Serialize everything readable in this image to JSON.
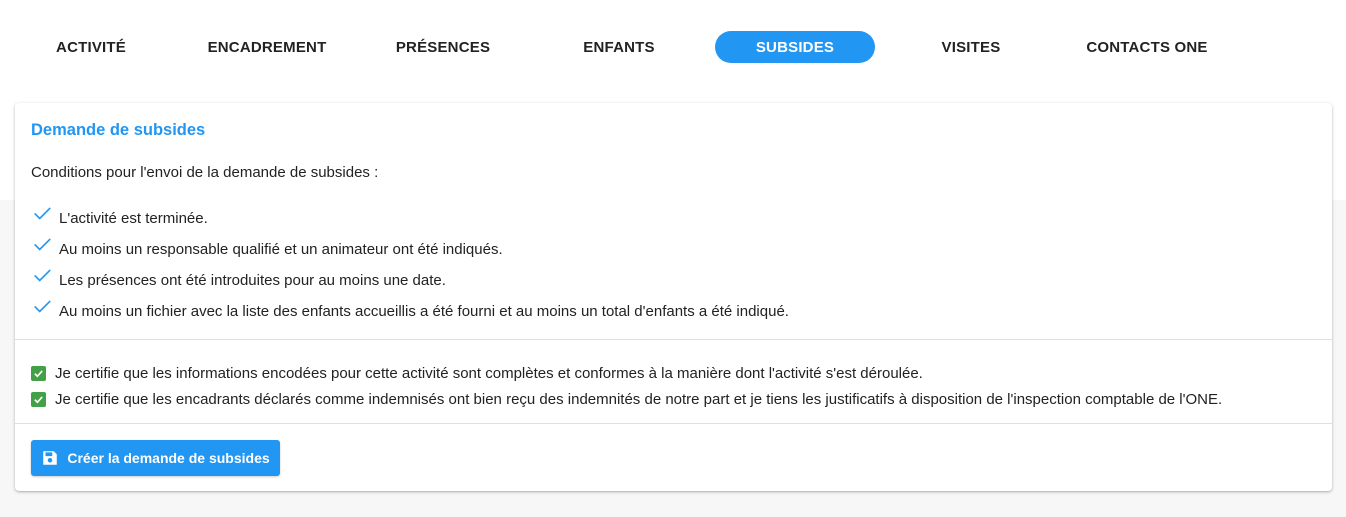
{
  "tabs": [
    {
      "label": "ACTIVITÉ",
      "active": false
    },
    {
      "label": "ENCADREMENT",
      "active": false
    },
    {
      "label": "PRÉSENCES",
      "active": false
    },
    {
      "label": "ENFANTS",
      "active": false
    },
    {
      "label": "SUBSIDES",
      "active": true
    },
    {
      "label": "VISITES",
      "active": false
    },
    {
      "label": "CONTACTS ONE",
      "active": false
    }
  ],
  "card": {
    "title": "Demande de subsides",
    "intro": "Conditions pour l'envoi de la demande de subsides :",
    "conditions": [
      {
        "text": "L'activité est terminée.",
        "icon": "check-icon"
      },
      {
        "text": "Au moins un responsable qualifié et un animateur ont été indiqués.",
        "icon": "check-icon"
      },
      {
        "text": "Les présences ont été introduites pour au moins une date.",
        "icon": "check-icon"
      },
      {
        "text": "Au moins un fichier avec la liste des enfants accueillis a été fourni et au moins un total d'enfants a été indiqué.",
        "icon": "check-icon"
      }
    ],
    "certifications": [
      {
        "text": "Je certifie que les informations encodées pour cette activité sont complètes et conformes à la manière dont l'activité s'est déroulée.",
        "checked": true
      },
      {
        "text": "Je certifie que les encadrants déclarés comme indemnisés ont bien reçu des indemnités de notre part et je tiens les justificatifs à disposition de l'inspection comptable de l'ONE.",
        "checked": true
      }
    ],
    "create_button": {
      "label": "Créer la demande de subsides",
      "icon": "save-icon"
    }
  },
  "colors": {
    "accent": "#2196f3",
    "checkbox": "#43a047",
    "background": "#f7f7f7"
  }
}
